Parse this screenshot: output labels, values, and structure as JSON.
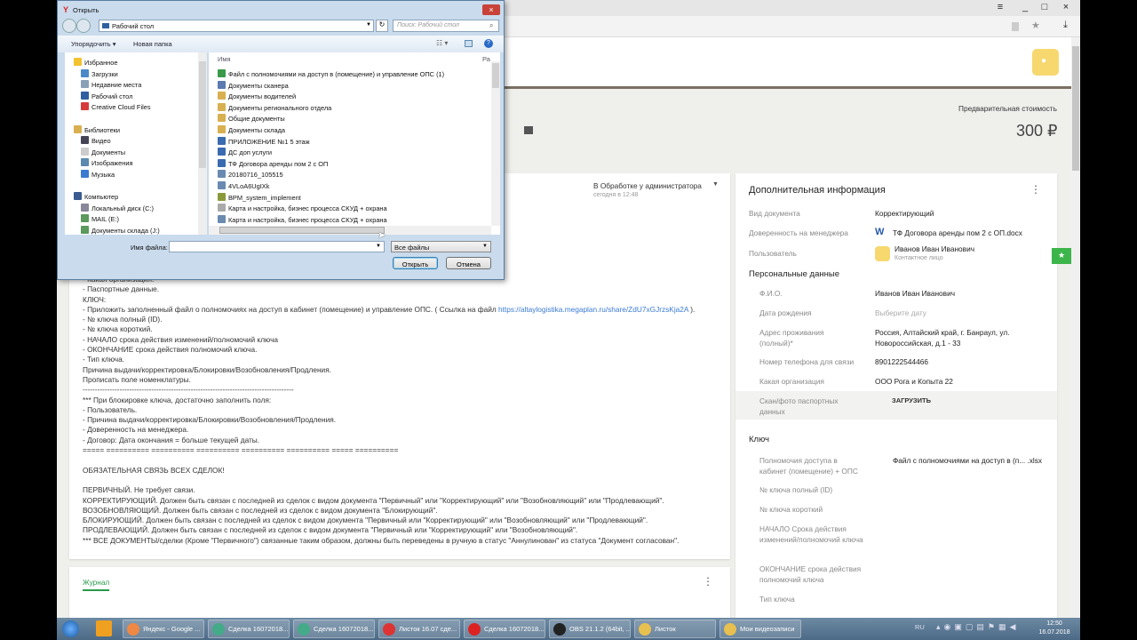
{
  "browser": {
    "menu_icon": "menu-icon",
    "min": "_",
    "max": "□",
    "close": "×"
  },
  "page": {
    "estimate_label": "Предварительная стоимость",
    "estimate_value": "300 ₽"
  },
  "deal": {
    "status": "В Обработке у администратора",
    "status_time": "сегодня в 12:48",
    "description": [
      "- Какая организация.",
      "- Паспортные данные.",
      "КЛЮЧ:",
      "- Приложить заполненный файл о полномочиях на доступ в кабинет (помещение) и управление ОПС. ( Ссылка на файл ",
      "- № ключа полный (ID).",
      "- № ключа короткий.",
      "- НАЧАЛО срока действия изменений/полномочий ключа",
      "- ОКОНЧАНИЕ срока действия полномочий ключа.",
      "- Тип ключа.",
      "Причина выдачи/корректировка/Блокировки/Возобновления/Продления.",
      "Прописать поле номенклатуры.",
      "--------------------------------------------------------------------------------------",
      "*** При блокировке ключа, достаточно заполнить поля:",
      "- Пользователь.",
      "- Причина выдачи/корректировка/Блокировки/Возобновления/Продления.",
      "- Доверенность на менеджера.",
      "- Договор: Дата окончания = больше текущей даты.",
      "===== ========== ========== ========== ========== ========== ===== ==========",
      "",
      "ОБЯЗАТЕЛЬНАЯ СВЯЗЬ ВСЕХ СДЕЛОК!",
      "",
      "ПЕРВИЧНЫЙ. Не требует связи.",
      "КОРРЕКТИРУЮЩИЙ. Должен быть связан с последней из сделок с видом документа \"Первичный\" или \"Корректирующий\" или \"Возобновляющий\" или \"Продлевающий\".",
      "ВОЗОБНОВЛЯЮЩИЙ. Должен быть связан с последней из сделок с видом документа \"Блокирующий\".",
      "БЛОКИРУЮЩИЙ. Должен быть связан с последней из сделок с видом документа \"Первичный или \"Корректирующий\" или \"Возобновляющий\" или \"Продлевающий\".",
      "ПРОДЛЕВАЮЩИЙ. Должен быть связан с последней из сделок с видом документа \"Первичный или \"Корректирующий\" или \"Возобновляющий\".",
      "*** ВСЕ ДОКУМЕНТЫ/сделки (Кроме \"Первичного\") связанные таким образом, должны быть переведены в ручную в статус \"Аннулинован\" из статуса \"Документ согласован\"."
    ],
    "link": "https://altaylogistika.megaplan.ru/share/ZdU7xGJrzsKja2A",
    "link_suffix": " ).",
    "journal_tab": "Журнал"
  },
  "info": {
    "title": "Дополнительная информация",
    "doc_type_label": "Вид документа",
    "doc_type": "Корректирующий",
    "proxy_label": "Доверенность на менеджера",
    "proxy_file": "ТФ Договора аренды пом 2 с ОП.docx",
    "user_label": "Пользователь",
    "user_name": "Иванов Иван Иванович",
    "user_role": "Контактное лицо",
    "personal_title": "Персональные данные",
    "personal": [
      {
        "label": "Ф.И.О.",
        "value": "Иванов Иван Иванович"
      },
      {
        "label": "Дата рождения",
        "value": "Выберите дату"
      },
      {
        "label": "Адрес проживания (полный)*",
        "value": "Россия, Алтайский край, г. Банраул, ул. Новороссийская, д.1 - 33"
      },
      {
        "label": "Номер телефона для связи",
        "value": "8901222544466"
      },
      {
        "label": "Какая организация",
        "value": "ООО Рога и Копыта 22"
      },
      {
        "label": "Скан/фото паспортных данных",
        "value": "ЗАГРУЗИТЬ"
      }
    ],
    "key_title": "Ключ",
    "key": [
      {
        "label": "Полномочия доступа в кабинет (помещение) + ОПС",
        "value": "Файл с полномочиями на доступ в (п... .xlsx"
      },
      {
        "label": "№ ключа полный (ID)",
        "value": ""
      },
      {
        "label": "№ ключа короткий",
        "value": ""
      },
      {
        "label": "НАЧАЛО Срока действия изменений/полномочий ключа",
        "value": ""
      },
      {
        "label": "ОКОНЧАНИЕ срока действия полномочий ключа",
        "value": ""
      },
      {
        "label": "Тип ключа",
        "value": ""
      }
    ]
  },
  "dialog": {
    "title": "Открыть",
    "location": "Рабочий стол",
    "search_placeholder": "Поиск: Рабочий стол",
    "organize": "Упорядочить ▾",
    "new_folder": "Новая папка",
    "col_name": "Имя",
    "col_size": "Ра",
    "nav": [
      {
        "label": "Избранное",
        "color": "#f2c230",
        "indent": 0
      },
      {
        "label": "Загрузки",
        "color": "#4a8ac8",
        "indent": 1
      },
      {
        "label": "Недавние места",
        "color": "#8aa0b8",
        "indent": 1
      },
      {
        "label": "Рабочий стол",
        "color": "#2f5fa0",
        "indent": 1
      },
      {
        "label": "Creative Cloud Files",
        "color": "#d83a3a",
        "indent": 1
      },
      {
        "label": "",
        "color": "",
        "indent": 1
      },
      {
        "label": "Библиотеки",
        "color": "#d8b050",
        "indent": 0
      },
      {
        "label": "Видео",
        "color": "#445",
        "indent": 1
      },
      {
        "label": "Документы",
        "color": "#ccc",
        "indent": 1
      },
      {
        "label": "Изображения",
        "color": "#5a8ab0",
        "indent": 1
      },
      {
        "label": "Музыка",
        "color": "#3a7ad0",
        "indent": 1
      },
      {
        "label": "",
        "color": "",
        "indent": 1
      },
      {
        "label": "Компьютер",
        "color": "#3a5a90",
        "indent": 0
      },
      {
        "label": "Локальный диск (C:)",
        "color": "#889",
        "indent": 1
      },
      {
        "label": "MAIL (E:)",
        "color": "#5a9a5a",
        "indent": 1
      },
      {
        "label": "Документы склада (J:)",
        "color": "#5a9a5a",
        "indent": 1
      }
    ],
    "files": [
      {
        "name": "Файл с полномочиями на доступ в (помещение) и управление ОПС (1)",
        "color": "#3a9a4a"
      },
      {
        "name": "Документы сканера",
        "color": "#5a7ab0"
      },
      {
        "name": "Документы водителей",
        "color": "#d8b050"
      },
      {
        "name": "Документы регионального отдела",
        "color": "#d8b050"
      },
      {
        "name": "Общие документы",
        "color": "#d8b050"
      },
      {
        "name": "Документы склада",
        "color": "#d8b050"
      },
      {
        "name": "ПРИЛОЖЕНИЕ №1 5 этаж",
        "color": "#3a6ab0"
      },
      {
        "name": "ДС доп услуги",
        "color": "#3a6ab0"
      },
      {
        "name": "ТФ Договора аренды пом 2 с ОП",
        "color": "#3a6ab0"
      },
      {
        "name": "20180716_105515",
        "color": "#6a8ab0"
      },
      {
        "name": "4VLoA6UgIXk",
        "color": "#6a8ab0"
      },
      {
        "name": "BPM_system_implement",
        "color": "#8a9a3a"
      },
      {
        "name": "Карта и настройка, бизнес процесса СКУД + охрана",
        "color": "#aaa"
      },
      {
        "name": "Карта и настройка, бизнес процесса СКУД + охрана",
        "color": "#6a8ab0"
      }
    ],
    "filename_label": "Имя файла:",
    "filename_value": "",
    "filter": "Все файлы",
    "open": "Открыть",
    "cancel": "Отмена"
  },
  "taskbar": {
    "items": [
      "",
      "",
      "Яндекс - Google ...",
      "Сделка 16072018...",
      "Сделка 16072018...",
      "Листок 16.07 сде...",
      "Сделка 16072018...",
      "OBS 21.1.2 (64bit, ...",
      "Листок",
      "Мои видеозаписи"
    ],
    "lang": "RU",
    "time": "12:50",
    "date": "16.07.2018"
  }
}
